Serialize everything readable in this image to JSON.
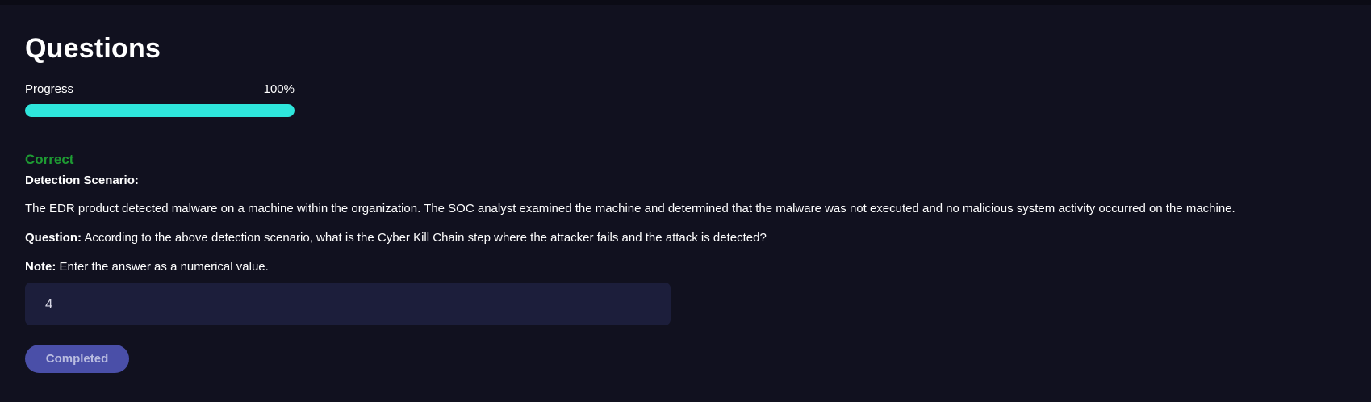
{
  "page": {
    "title": "Questions"
  },
  "progress": {
    "label": "Progress",
    "percent_text": "100%",
    "value": 1.0,
    "fill_color": "#2ee6dc"
  },
  "question": {
    "status": "Correct",
    "status_color": "#1e9b33",
    "scenario_heading": "Detection Scenario:",
    "scenario_text": "The EDR product detected malware on a machine within the organization. The SOC analyst examined the machine and determined that the malware was not executed and no malicious system activity occurred on the machine.",
    "question_label": "Question:",
    "question_text": "According to the above detection scenario, what is the Cyber Kill Chain step where the attacker fails and the attack is detected?",
    "note_label": "Note:",
    "note_text": "Enter the answer as a numerical value.",
    "answer_value": "4",
    "submit_label": "Completed"
  }
}
